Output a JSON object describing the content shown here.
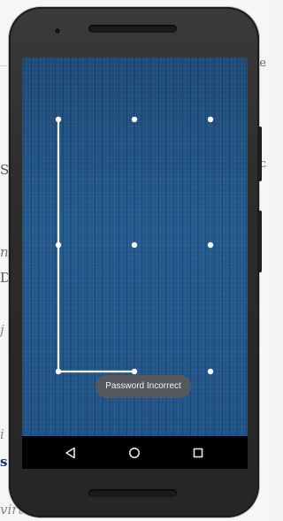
{
  "background_editor": {
    "lines": [
      "S",
      "n",
      "D",
      "j",
      "i",
      "s",
      "virt"
    ],
    "right_marks": [
      "e",
      "c"
    ]
  },
  "lock_screen": {
    "pattern_dot_count": 9,
    "toast_message": "Password Incorrect"
  },
  "nav_bar": {
    "buttons": [
      "back-icon",
      "home-icon",
      "recents-icon"
    ]
  },
  "colors": {
    "screen_blue": "#1f5286",
    "pattern_line": "#ffffff",
    "toast_bg": "#5a5a5a",
    "nav_bg": "#000000"
  }
}
